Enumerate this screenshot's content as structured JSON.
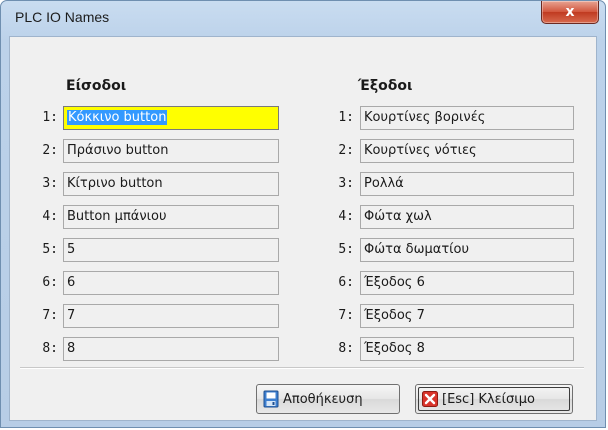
{
  "window": {
    "title": "PLC IO Names",
    "close_glyph": "x"
  },
  "inputs": {
    "heading": "Είσοδοι",
    "rows": [
      {
        "num": "1:",
        "value": "Κόκκινο button"
      },
      {
        "num": "2:",
        "value": "Πράσινο button"
      },
      {
        "num": "3:",
        "value": "Κίτρινο button"
      },
      {
        "num": "4:",
        "value": "Button μπάνιου"
      },
      {
        "num": "5:",
        "value": "5"
      },
      {
        "num": "6:",
        "value": "6"
      },
      {
        "num": "7:",
        "value": "7"
      },
      {
        "num": "8:",
        "value": "8"
      }
    ]
  },
  "outputs": {
    "heading": "Έξοδοι",
    "rows": [
      {
        "num": "1:",
        "value": "Κουρτίνες βορινές"
      },
      {
        "num": "2:",
        "value": "Κουρτίνες νότιες"
      },
      {
        "num": "3:",
        "value": "Ρολλά"
      },
      {
        "num": "4:",
        "value": "Φώτα χωλ"
      },
      {
        "num": "5:",
        "value": "Φώτα δωματίου"
      },
      {
        "num": "6:",
        "value": "Έξοδος 6"
      },
      {
        "num": "7:",
        "value": "Έξοδος 7"
      },
      {
        "num": "8:",
        "value": "Έξοδος 8"
      }
    ]
  },
  "buttons": {
    "save_label": "Αποθήκευση",
    "close_label": "[Esc] Κλείσιμο",
    "save_icon": "save-disk-icon",
    "close_icon": "red-x-icon"
  },
  "colors": {
    "active_field": "#ffff00",
    "selection": "#3399ff",
    "close_button": "#c9452c"
  }
}
